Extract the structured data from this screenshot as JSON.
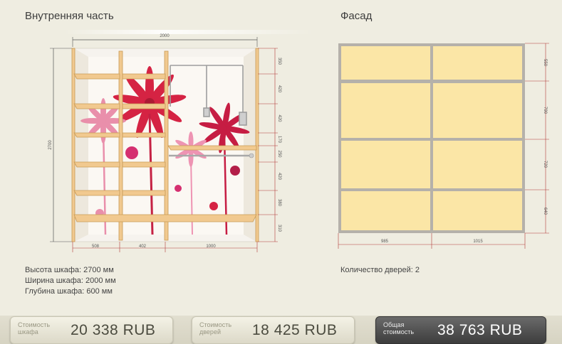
{
  "sections": {
    "inner_title": "Внутренняя часть",
    "facade_title": "Фасад"
  },
  "inner": {
    "total_width": "2000",
    "total_height": "2700",
    "bottom_widths": [
      "508",
      "402",
      "1000"
    ],
    "right_heights": [
      "350",
      "420",
      "420",
      "170",
      "250",
      "420",
      "380",
      "310"
    ],
    "info": [
      "Высота шкафа: 2700 мм",
      "Ширина шкафа: 2000 мм",
      "Глубина шкафа: 600 мм"
    ]
  },
  "facade": {
    "bottom_widths": [
      "985",
      "1015"
    ],
    "right_heights": [
      "550",
      "790",
      "720",
      "640"
    ],
    "info": "Количество дверей: 2",
    "panel_color": "#fbe6a6",
    "frame_color": "#b5b1aa"
  },
  "costs": {
    "cabinet": {
      "label_line1": "Стоимость",
      "label_line2": "шкафа",
      "value": "20 338  RUB"
    },
    "doors": {
      "label_line1": "Стоимость",
      "label_line2": "дверей",
      "value": "18 425  RUB"
    },
    "total": {
      "label_line1": "Общая",
      "label_line2": "стоимость",
      "value": "38 763  RUB"
    }
  },
  "colors": {
    "wood": "#f1c98f",
    "wood_edge": "#c89a55",
    "dimension_line": "#b23a3a",
    "flower_red": "#d4183a",
    "flower_pink": "#e98aa8"
  }
}
